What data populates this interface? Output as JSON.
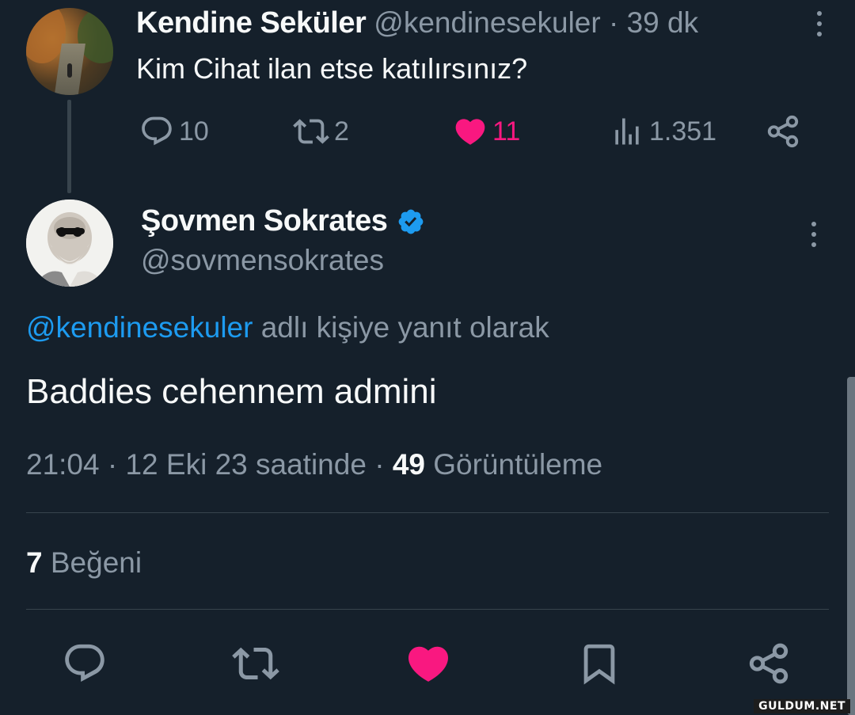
{
  "parent_tweet": {
    "display_name": "Kendine Seküler",
    "handle": "@kendinesekuler",
    "separator": "·",
    "time": "39 dk",
    "text": "Kim Cihat ilan etse katılırsınız?",
    "replies": "10",
    "retweets": "2",
    "likes": "11",
    "views": "1.351"
  },
  "main_tweet": {
    "display_name": "Şovmen Sokrates",
    "handle": "@sovmensokrates",
    "reply_to_handle": "@kendinesekuler",
    "reply_to_suffix": "adlı kişiye yanıt olarak",
    "text": "Baddies cehennem admini",
    "timestamp": "21:04 · 12 Eki 23 saatinde",
    "meta_separator": "·",
    "view_count": "49",
    "view_label": "Görüntüleme",
    "like_count": "7",
    "like_label": "Beğeni"
  },
  "watermark": "GULDUM.NET",
  "colors": {
    "background": "#15202b",
    "text": "#f7f9f9",
    "muted": "#8b98a5",
    "link": "#1d9bf0",
    "like": "#f91880",
    "divider": "#38444d"
  },
  "icons": [
    "reply-icon",
    "retweet-icon",
    "like-icon",
    "views-icon",
    "share-icon",
    "bookmark-icon",
    "verified-badge-icon",
    "more-icon"
  ]
}
